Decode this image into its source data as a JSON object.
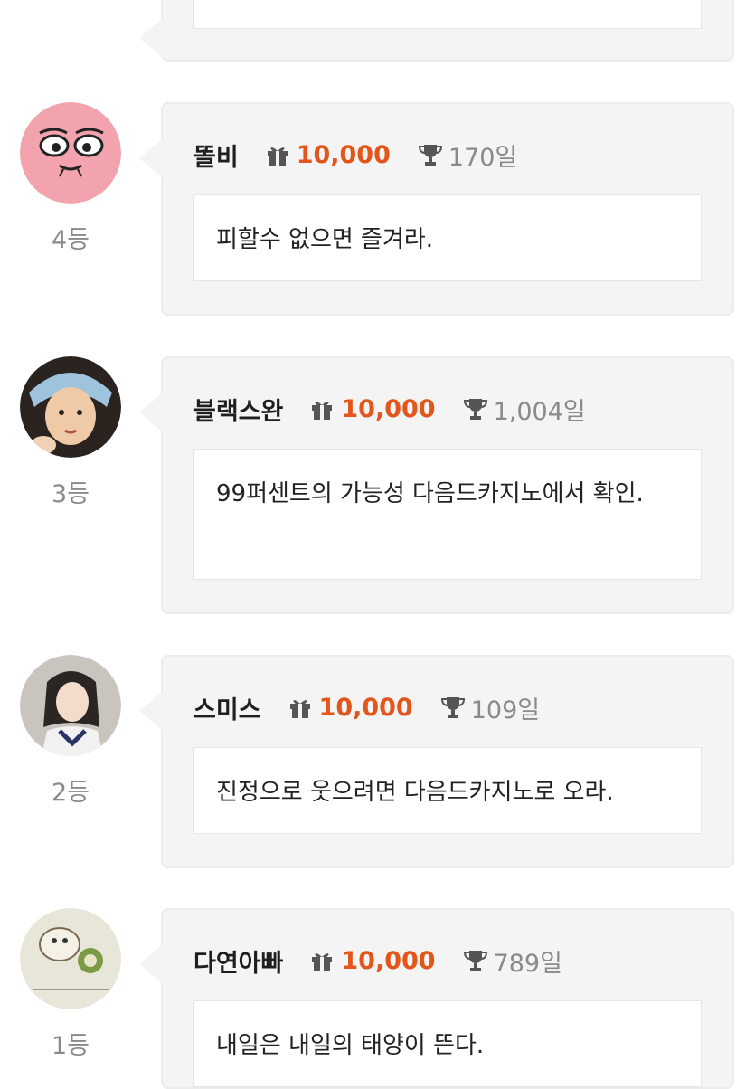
{
  "entries": [
    {
      "nickname": "똘비",
      "gift": "10,000",
      "days": "170일",
      "comment": "피할수 없으면 즐겨라.",
      "rank": "4등"
    },
    {
      "nickname": "블랙스완",
      "gift": "10,000",
      "days": "1,004일",
      "comment": "99퍼센트의 가능성 다음드카지노에서 확인.",
      "rank": "3등"
    },
    {
      "nickname": "스미스",
      "gift": "10,000",
      "days": "109일",
      "comment": "진정으로 웃으려면 다음드카지노로 오라.",
      "rank": "2등"
    },
    {
      "nickname": "다연아빠",
      "gift": "10,000",
      "days": "789일",
      "comment": "내일은 내일의 태양이 뜬다.",
      "rank": "1등"
    }
  ],
  "icons": {
    "gift": "gift-icon",
    "trophy": "trophy-icon"
  },
  "colors": {
    "amount": "#e2561c",
    "card_bg": "#f4f4f4",
    "muted": "#8a8a8a"
  }
}
